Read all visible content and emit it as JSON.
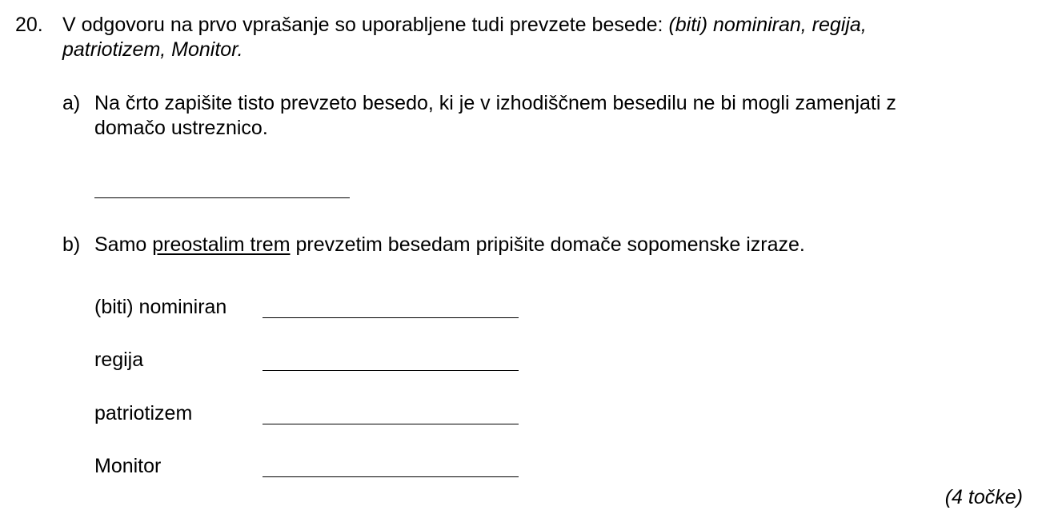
{
  "question": {
    "number": "20.",
    "text_plain": "V odgovoru na prvo vprašanje so uporabljene tudi prevzete besede: ",
    "text_italic_line1": "(biti) nominiran, regija,",
    "text_italic_line2": "patriotizem, Monitor."
  },
  "part_a": {
    "letter": "a)",
    "text_line1": "Na črto zapišite tisto prevzeto besedo, ki je v izhodiščnem besedilu ne bi mogli zamenjati z",
    "text_line2": "domačo ustreznico."
  },
  "part_b": {
    "letter": "b)",
    "text_before": "Samo ",
    "text_underlined": "preostalim trem",
    "text_after": " prevzetim besedam pripišite domače sopomenske izraze."
  },
  "terms": [
    {
      "label": "(biti) nominiran"
    },
    {
      "label": "regija"
    },
    {
      "label": "patriotizem"
    },
    {
      "label": "Monitor"
    }
  ],
  "points": "(4 točke)"
}
